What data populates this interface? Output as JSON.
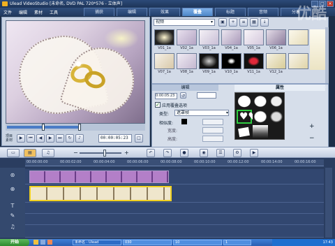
{
  "window": {
    "title": "Ulead VideoStudio [未命名, DVD PAL 720*576 - 立体声]"
  },
  "menu": [
    "文件",
    "编辑",
    "素材",
    "工具"
  ],
  "steps_tabs": [
    {
      "label": "捕获",
      "active": false
    },
    {
      "label": "编辑",
      "active": false
    },
    {
      "label": "效果",
      "active": false
    },
    {
      "label": "覆叠",
      "active": true
    },
    {
      "label": "标题",
      "active": false
    },
    {
      "label": "音频",
      "active": false
    },
    {
      "label": "分享",
      "active": false
    }
  ],
  "preview": {
    "mode_a": "项目",
    "mode_b": "素材",
    "timecode": "00:00:05:23"
  },
  "library": {
    "dropdown": "视频",
    "thumbnails": [
      "V01_1a",
      "V02_1a",
      "V03_1a",
      "V04_1a",
      "V05_1a",
      "V06_1a",
      "V07_1a",
      "V08_1a",
      "V09_1a",
      "V10_1a",
      "V11_1a",
      "V12_1a"
    ]
  },
  "attributes": {
    "tab_edit": "编辑",
    "tab_attr": "属性",
    "duration": "0:00:05:23",
    "overlay_checkbox": "应用覆叠选项",
    "type_label": "类型:",
    "type_value": "遮罩帧",
    "similar_label": "相似度:",
    "width_label": "宽度:",
    "height_label": "高度:"
  },
  "timeline": {
    "ruler": [
      "00:00:00:00",
      "00:00:02:00",
      "00:00:04:00",
      "00:00:06:00",
      "00:00:08:00",
      "00:00:10:00",
      "00:00:12:00",
      "00:00:14:00",
      "00:00:16:00"
    ]
  },
  "taskbar": {
    "start": "开始",
    "windows": [
      "未命名 - Ulead",
      "030",
      "10",
      "1"
    ],
    "clock": "17:43"
  },
  "watermark": "优酷",
  "colors": {
    "accent": "#4d86c8",
    "titlebar": "#2c4a78",
    "timeline_bg": "#2a3d60"
  }
}
